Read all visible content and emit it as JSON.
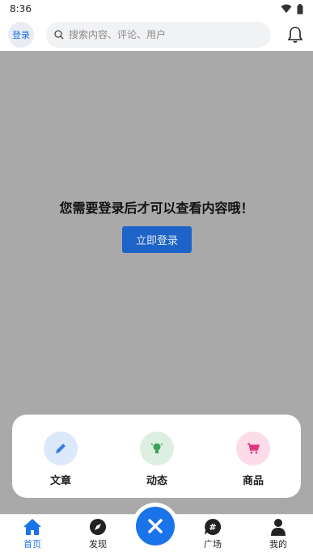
{
  "status_bar": {
    "time": "8:36"
  },
  "header": {
    "login_label": "登录",
    "search_placeholder": "搜索内容、评论、用户"
  },
  "overlay": {
    "message": "您需要登录后才可以查看内容哦！",
    "login_button": "立即登录"
  },
  "publish_menu": {
    "items": [
      {
        "label": "文章",
        "icon": "pencil-icon",
        "color": "#3b7de0"
      },
      {
        "label": "动态",
        "icon": "lightbulb-icon",
        "color": "#3aa45a"
      },
      {
        "label": "商品",
        "icon": "cart-icon",
        "color": "#e0327a"
      }
    ]
  },
  "tab_bar": {
    "tabs": [
      {
        "label": "首页",
        "icon": "home-icon",
        "active": true
      },
      {
        "label": "发现",
        "icon": "compass-icon",
        "active": false
      },
      {
        "label": "广场",
        "icon": "hash-chat-icon",
        "active": false
      },
      {
        "label": "我的",
        "icon": "person-icon",
        "active": false
      }
    ]
  },
  "colors": {
    "accent": "#1a73e8",
    "overlay": "#a9a9a9",
    "login_button": "#1e63c7"
  }
}
